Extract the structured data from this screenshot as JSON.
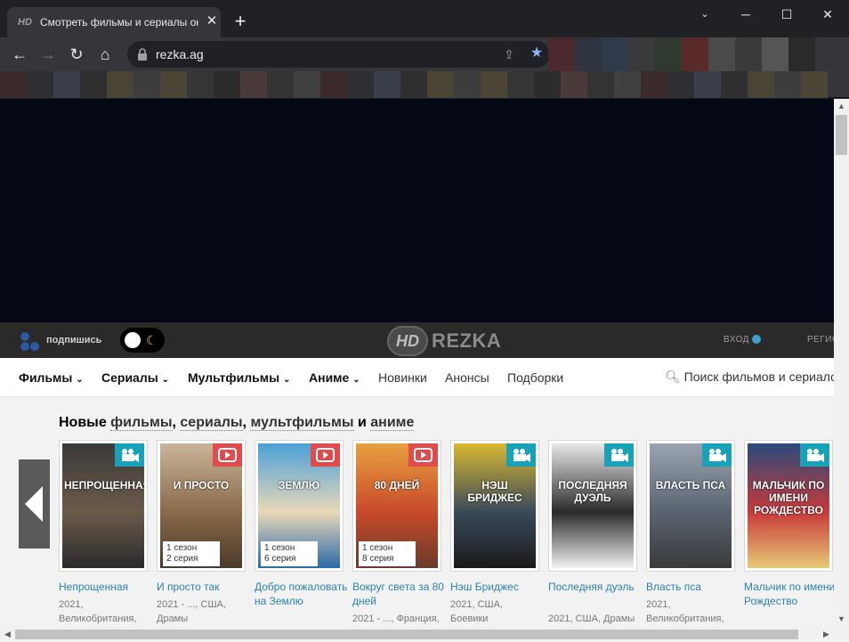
{
  "browser": {
    "tab_favicon": "HD",
    "tab_title": "Смотреть фильмы и сериалы онлайн",
    "url": "rezka.ag",
    "bookmark_colors": [
      "#4a2a2e",
      "#2e3440",
      "#2f3a4a",
      "#3a3a3a",
      "#2e3a2e",
      "#5a2a2a",
      "#4a4a4a",
      "#3a3a3a",
      "#555555",
      "#2a2a2a"
    ]
  },
  "site": {
    "subscribe_label": "подпишись",
    "logo_hd": "HD",
    "logo_text": "REZKA",
    "login_label": "ВХОД",
    "register_label": "РЕГИСТРАЦИЯ"
  },
  "menu": {
    "films": "Фильмы",
    "series": "Сериалы",
    "cartoons": "Мультфильмы",
    "anime": "Аниме",
    "new": "Новинки",
    "announcements": "Анонсы",
    "collections": "Подборки",
    "search_placeholder": "Поиск фильмов и сериалов"
  },
  "section": {
    "prefix": "Новые ",
    "films": "фильмы",
    "sep1": ", ",
    "series": "сериалы",
    "sep2": ", ",
    "cartoons": "мультфильмы",
    "and": " и ",
    "anime": "аниме"
  },
  "cards": [
    {
      "title": "Непрощенная",
      "poster_text": "НЕПРОЩЕННАЯ",
      "type": "film",
      "info1": "2021,",
      "info2": "Великобритания,",
      "season": "",
      "episode": "",
      "colors": [
        "#3a3a3a",
        "#6b5a4a",
        "#2a2a2a"
      ]
    },
    {
      "title": "И просто так",
      "poster_text": "И ПРОСТО",
      "type": "serial",
      "info1": "2021 - ..., США,",
      "info2": "Драмы",
      "season": "1 сезон",
      "episode": "2 серия",
      "colors": [
        "#c8b59a",
        "#8a6a4a",
        "#4a3a2a"
      ]
    },
    {
      "title": "Добро пожаловать на Землю",
      "poster_text": "ЗЕМЛЮ",
      "type": "serial",
      "info1": "",
      "info2": "",
      "season": "1 сезон",
      "episode": "6 серия",
      "colors": [
        "#4aa0d8",
        "#e8d8b8",
        "#2a6aa8"
      ]
    },
    {
      "title": "Вокруг света за 80 дней",
      "poster_text": "80 ДНЕЙ",
      "type": "serial",
      "info1": "2021 - ..., Франция,",
      "info2": "",
      "season": "1 сезон",
      "episode": "8 серия",
      "colors": [
        "#e8a040",
        "#c84a2a",
        "#6a3a2a"
      ]
    },
    {
      "title": "Нэш Бриджес",
      "poster_text": "НЭШ БРИДЖЕС",
      "type": "film",
      "info1": "2021, США,",
      "info2": "Боевики",
      "season": "",
      "episode": "",
      "colors": [
        "#d8b830",
        "#3a4a5a",
        "#1a1a1a"
      ]
    },
    {
      "title": "Последняя дуэль",
      "poster_text": "ПОСЛЕДНЯЯ ДУЭЛЬ",
      "type": "film",
      "info1": "2021, США, Драмы",
      "info2": "",
      "season": "",
      "episode": "",
      "colors": [
        "#e8e8e8",
        "#2a2a2a",
        "#f2f2f2"
      ]
    },
    {
      "title": "Власть пса",
      "poster_text": "ВЛАСТЬ ПСА",
      "type": "film",
      "info1": "2021,",
      "info2": "Великобритания,",
      "season": "",
      "episode": "",
      "colors": [
        "#9aa4b0",
        "#5a6470",
        "#3a3a3a"
      ]
    },
    {
      "title": "Мальчик по имени Рождество",
      "poster_text": "МАЛЬЧИК ПО ИМЕНИ РОЖДЕСТВО",
      "type": "film",
      "info1": "",
      "info2": "",
      "season": "",
      "episode": "",
      "colors": [
        "#2a4a7a",
        "#c83a3a",
        "#e8c878"
      ]
    }
  ]
}
